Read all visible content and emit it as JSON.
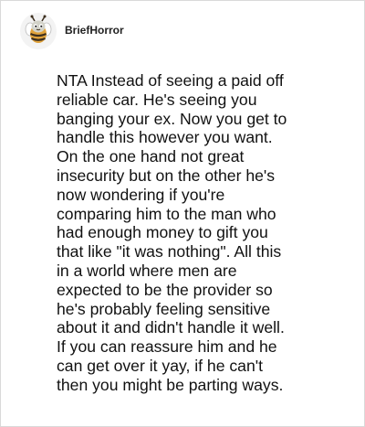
{
  "comment": {
    "author": "BriefHorror",
    "avatar_icon": "bee-mascot-icon",
    "text_lines": [
      "NTA Instead of seeing a paid off",
      "reliable car. He's seeing you",
      "banging your ex. Now you get to",
      "handle this however you want.",
      "On the one hand not great",
      "insecurity but on the other he's",
      "now wondering if you're",
      "comparing him to the man who",
      "had enough money to gift you",
      "that like \"it was nothing\". All this",
      "in a world where men are",
      "expected to be the provider so",
      "he's probably feeling sensitive",
      "about it and didn't handle it well.",
      "If you can reassure him and he",
      "can get over it yay, if he can't",
      "then you might be parting ways."
    ]
  },
  "colors": {
    "card_border": "#d9d9d9",
    "text": "#111111",
    "avatar_bg": "#f3f3f3"
  }
}
